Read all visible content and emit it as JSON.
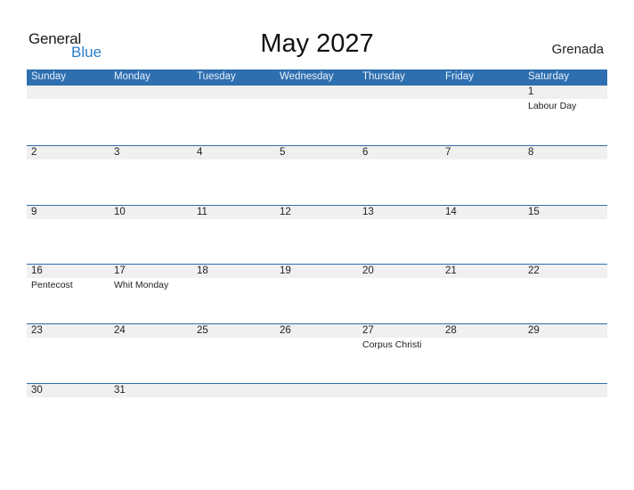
{
  "logo": {
    "word1": "General",
    "word2": "Blue"
  },
  "title": "May 2027",
  "country": "Grenada",
  "weekdays": [
    "Sunday",
    "Monday",
    "Tuesday",
    "Wednesday",
    "Thursday",
    "Friday",
    "Saturday"
  ],
  "weeks": [
    [
      "",
      "",
      "",
      "",
      "",
      "",
      "1"
    ],
    [
      "2",
      "3",
      "4",
      "5",
      "6",
      "7",
      "8"
    ],
    [
      "9",
      "10",
      "11",
      "12",
      "13",
      "14",
      "15"
    ],
    [
      "16",
      "17",
      "18",
      "19",
      "20",
      "21",
      "22"
    ],
    [
      "23",
      "24",
      "25",
      "26",
      "27",
      "28",
      "29"
    ],
    [
      "30",
      "31",
      "",
      "",
      "",
      "",
      ""
    ]
  ],
  "holidays": {
    "1": "Labour Day",
    "16": "Pentecost",
    "17": "Whit Monday",
    "27": "Corpus Christi"
  },
  "colors": {
    "accent": "#2e6fb0",
    "logo_blue": "#2a7fc9",
    "date_strip": "#f0f0f0"
  }
}
